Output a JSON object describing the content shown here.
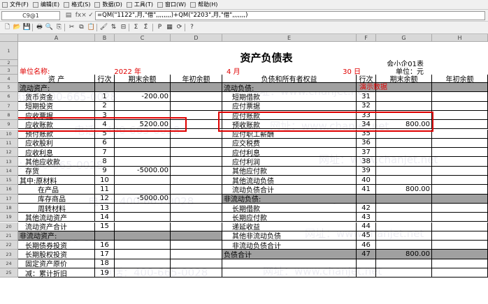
{
  "menu": [
    {
      "label": "文件(F)",
      "icon": "file-menu-icon"
    },
    {
      "label": "编辑(E)",
      "icon": "edit-menu-icon"
    },
    {
      "label": "格式(S)",
      "icon": "format-menu-icon"
    },
    {
      "label": "数据(D)",
      "icon": "data-menu-icon"
    },
    {
      "label": "工具(T)",
      "icon": "tools-menu-icon"
    },
    {
      "label": "窗口(W)",
      "icon": "window-menu-icon"
    },
    {
      "label": "帮助(H)",
      "icon": "help-menu-icon"
    }
  ],
  "formula_bar": {
    "name_box": "C9@1",
    "fx": "fx",
    "cancel": "×",
    "confirm": "✓",
    "formula": "=QM(\"1122\",月,\"借\",,,,,,,,)+QM(\"2203\",月,\"借\",,,,,,,)"
  },
  "toolbar": {
    "icons": [
      "new-icon",
      "open-icon",
      "save-icon",
      "print-icon",
      "print-preview-icon",
      "copy-format-icon",
      "cut-icon",
      "copy-icon",
      "paste-icon",
      "format-brush-icon",
      "sort-icon",
      "filter-icon",
      "sum-icon",
      "function-icon",
      "bold-p-icon",
      "chart-icon",
      "recalc-icon",
      "help-pointer-icon"
    ],
    "glyphs": [
      "🗋",
      "📂",
      "💾",
      "🖶",
      "🔍",
      "⎘",
      "✂",
      "⧉",
      "📋",
      "🖌",
      "⇅",
      "⊟",
      "Σ",
      "Σ̂",
      "P",
      "▦",
      "⟳",
      "?"
    ]
  },
  "columns": [
    "A",
    "B",
    "C",
    "D",
    "E",
    "F",
    "G",
    "H"
  ],
  "rows": [
    "1",
    "2",
    "3",
    "4",
    "5",
    "6",
    "7",
    "8",
    "9",
    "10",
    "11",
    "12",
    "13",
    "14",
    "15",
    "16",
    "17",
    "18",
    "19",
    "20",
    "21",
    "22",
    "23",
    "24",
    "25"
  ],
  "report": {
    "title": "资产负债表",
    "form_no": "会小企01表",
    "company_label": "单位名称:",
    "year": "2022 年",
    "month": "4 月",
    "day": "30 日",
    "unit": "单位：元",
    "demo_note": "演示数据",
    "headers": {
      "asset": "资        产",
      "row_no": "行次",
      "end_bal": "期末余额",
      "begin_bal": "年初余额",
      "liab": "负债和所有者权益",
      "row_no2": "行次",
      "end_bal2": "期末余额",
      "begin_bal2": "年初余额"
    },
    "left": [
      {
        "name": "流动资产:",
        "no": "",
        "end": "",
        "gray": true
      },
      {
        "name": "货币资金",
        "no": "1",
        "end": "-200.00"
      },
      {
        "name": "短期投资",
        "no": "2",
        "end": ""
      },
      {
        "name": "应收票据",
        "no": "3",
        "end": ""
      },
      {
        "name": "应收账款",
        "no": "4",
        "end": "5200.00"
      },
      {
        "name": "预付账款",
        "no": "5",
        "end": ""
      },
      {
        "name": "应收股利",
        "no": "6",
        "end": ""
      },
      {
        "name": "应收利息",
        "no": "7",
        "end": ""
      },
      {
        "name": "其他应收款",
        "no": "8",
        "end": ""
      },
      {
        "name": "存货",
        "no": "9",
        "end": "-5000.00"
      },
      {
        "name": "其中:原材料",
        "no": "10",
        "end": ""
      },
      {
        "name": "在产品",
        "no": "11",
        "end": ""
      },
      {
        "name": "库存商品",
        "no": "12",
        "end": "-5000.00"
      },
      {
        "name": "周转材料",
        "no": "13",
        "end": ""
      },
      {
        "name": "其他流动资产",
        "no": "14",
        "end": ""
      },
      {
        "name": "流动资产合计",
        "no": "15",
        "end": ""
      },
      {
        "name": "非流动资产:",
        "no": "",
        "end": "",
        "gray": true
      },
      {
        "name": "长期债券投资",
        "no": "16",
        "end": ""
      },
      {
        "name": "长期股权投资",
        "no": "17",
        "end": ""
      },
      {
        "name": "固定资产原价",
        "no": "18",
        "end": ""
      },
      {
        "name": "减：累计折旧",
        "no": "19",
        "end": ""
      }
    ],
    "right": [
      {
        "name": "流动负债:",
        "no": "",
        "end": "",
        "gray": true
      },
      {
        "name": "短期借款",
        "no": "31",
        "end": ""
      },
      {
        "name": "应付票据",
        "no": "32",
        "end": ""
      },
      {
        "name": "应付账款",
        "no": "33",
        "end": ""
      },
      {
        "name": "预收账款",
        "no": "34",
        "end": "800.00"
      },
      {
        "name": "应付职工薪酬",
        "no": "35",
        "end": ""
      },
      {
        "name": "应交税费",
        "no": "36",
        "end": ""
      },
      {
        "name": "应付利息",
        "no": "37",
        "end": ""
      },
      {
        "name": "应付利润",
        "no": "38",
        "end": ""
      },
      {
        "name": "其他应付款",
        "no": "39",
        "end": ""
      },
      {
        "name": "其他流动负债",
        "no": "40",
        "end": ""
      },
      {
        "name": "流动负债合计",
        "no": "41",
        "end": "800.00"
      },
      {
        "name": "非流动负债:",
        "no": "",
        "end": "",
        "gray": true
      },
      {
        "name": "长期借款",
        "no": "42",
        "end": ""
      },
      {
        "name": "长期应付款",
        "no": "43",
        "end": ""
      },
      {
        "name": "递延收益",
        "no": "44",
        "end": ""
      },
      {
        "name": "其他非流动负债",
        "no": "45",
        "end": ""
      },
      {
        "name": "非流动负债合计",
        "no": "46",
        "end": ""
      },
      {
        "name": "负债合计",
        "no": "47",
        "end": "800.00",
        "gray": true
      },
      {
        "name": "",
        "no": "",
        "end": ""
      },
      {
        "name": "",
        "no": "",
        "end": ""
      }
    ]
  },
  "watermarks": [
    "电话：400-665-0028",
    "网址：www.chanjet.net",
    "电话：400-665-0028",
    "网址：www.chanjet.net",
    "电话：400-665-0028",
    "网址：www.chanjet.net",
    "电话：400-665-0028",
    "网址：www.chanjet.net",
    "电话：400-665-0028",
    "网址：www.chanjet.net",
    "电话：400-665-0028",
    "网址：www.chanjet.net"
  ],
  "colors": {
    "highlight": "#e00000",
    "section_gray": "#a0a0a0",
    "red_text": "#e00000"
  }
}
